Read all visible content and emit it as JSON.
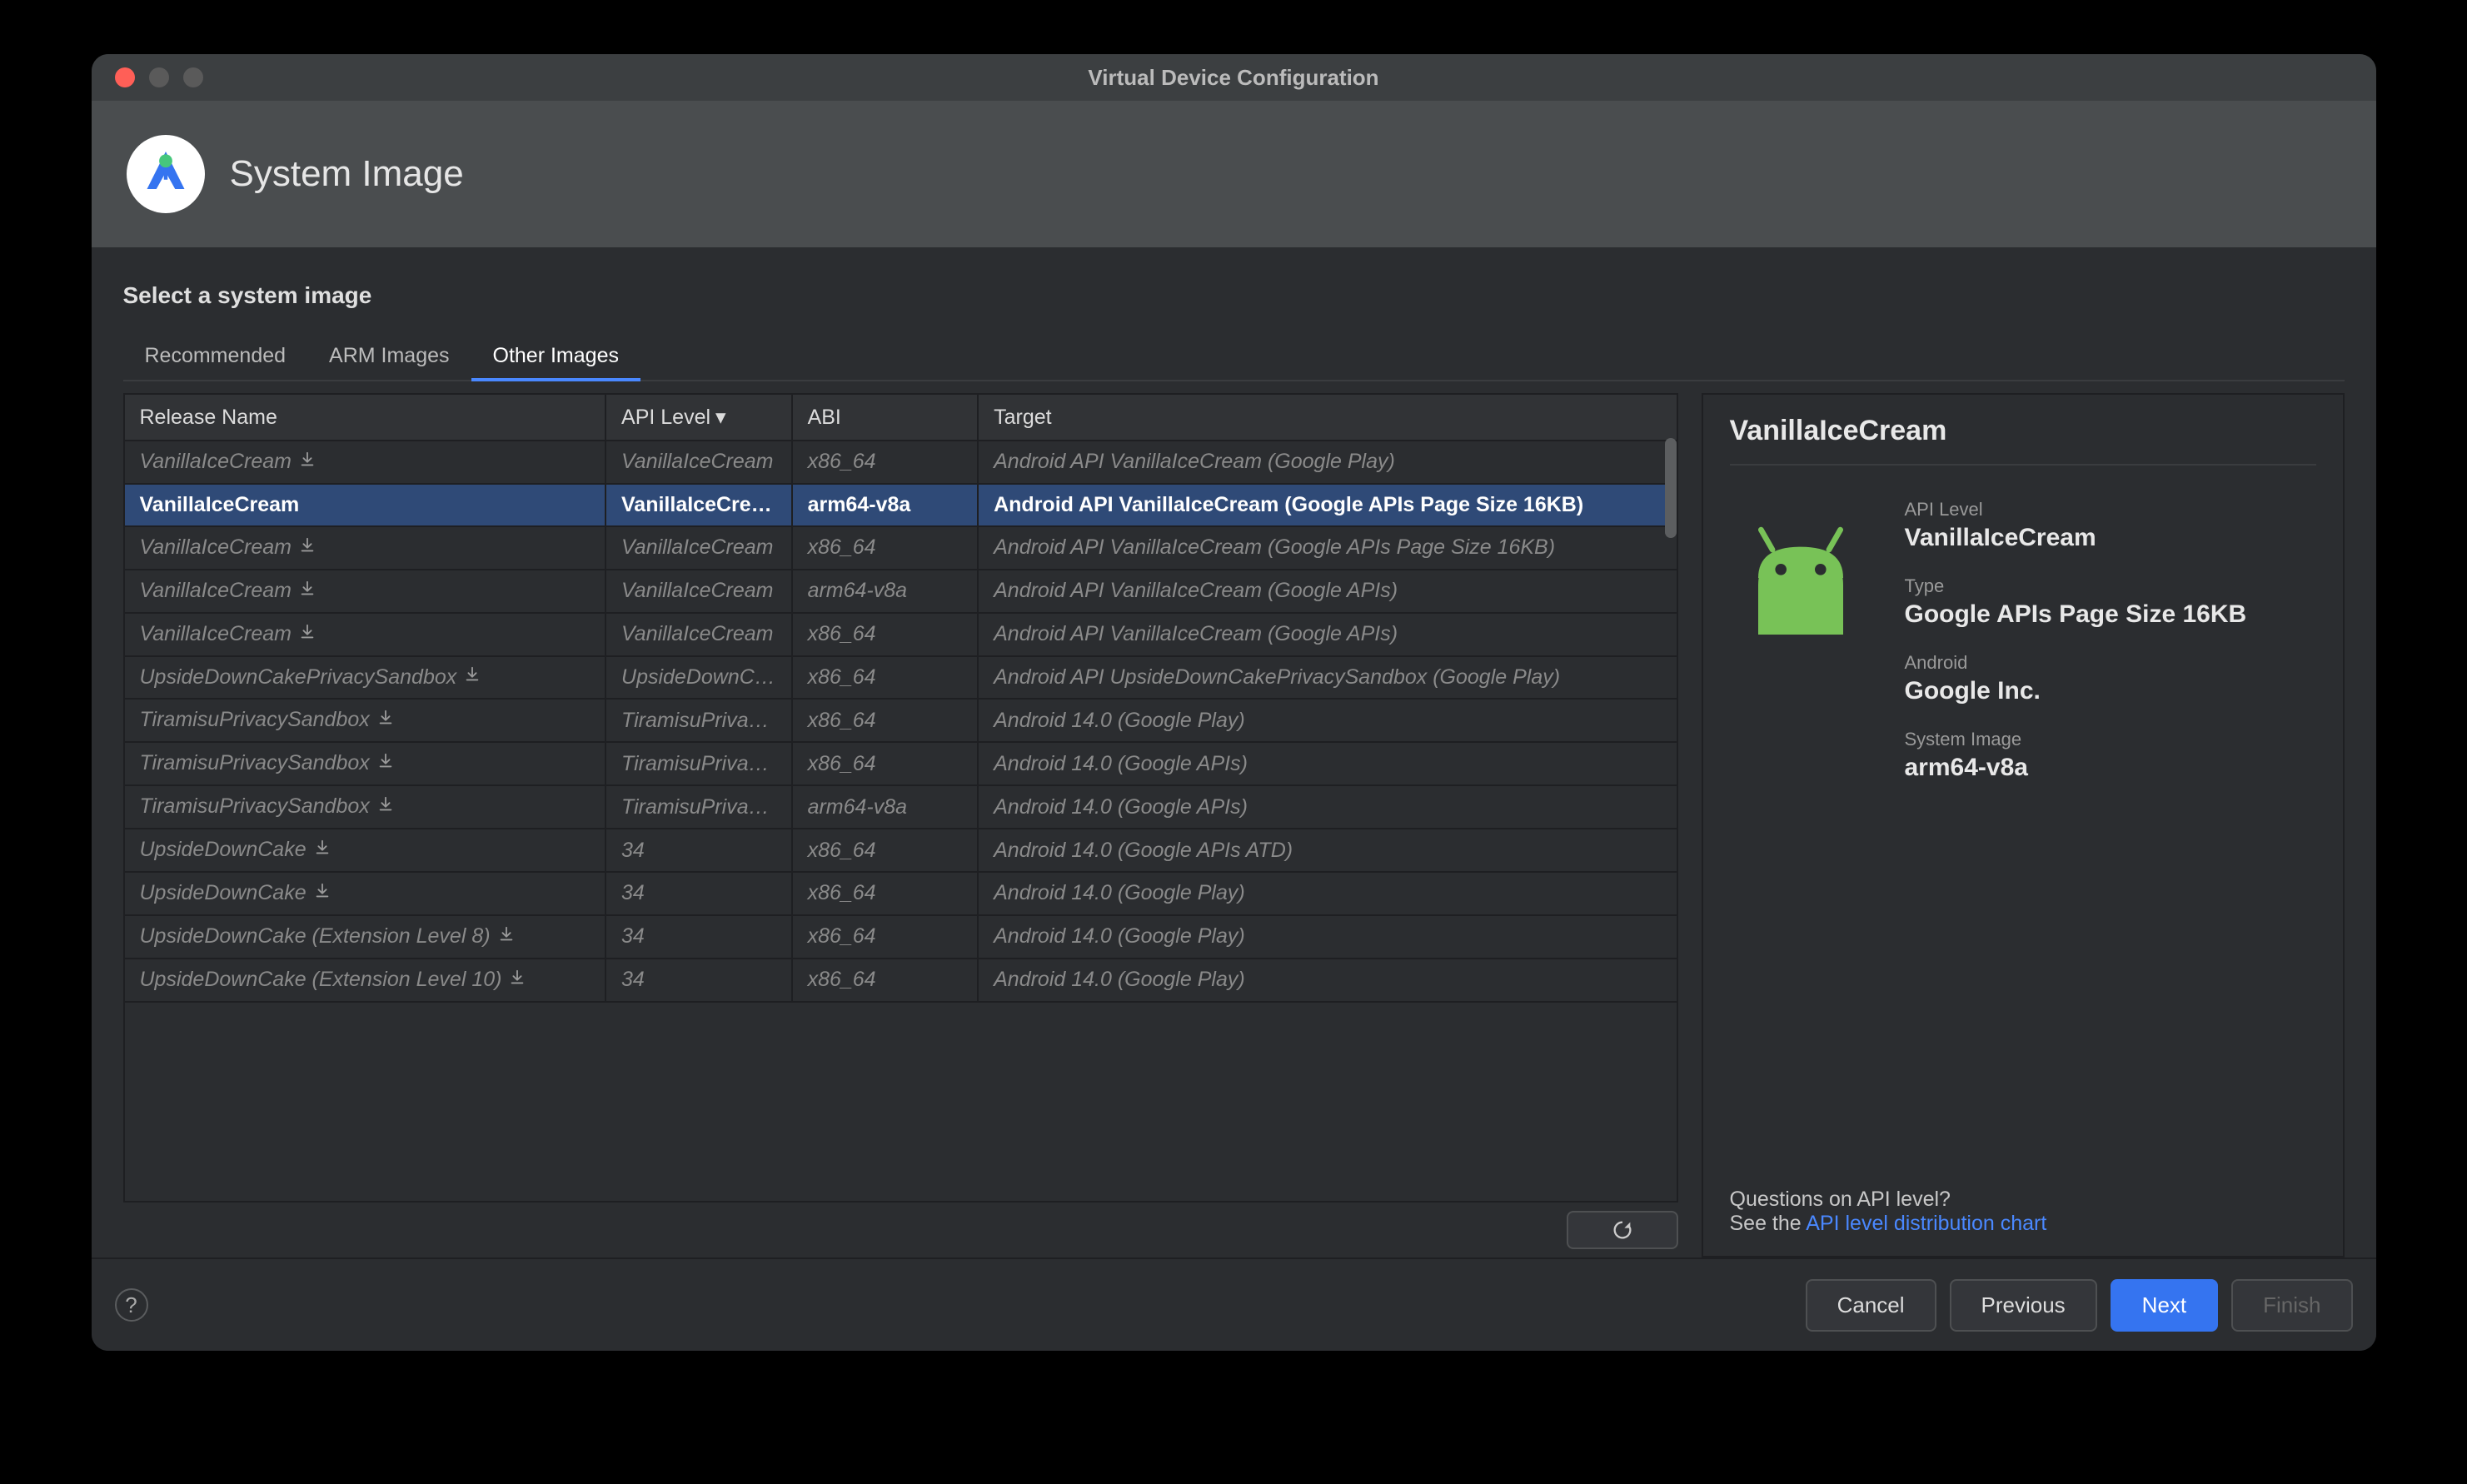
{
  "window": {
    "title": "Virtual Device Configuration"
  },
  "header": {
    "title": "System Image"
  },
  "subtitle": "Select a system image",
  "tabs": [
    {
      "label": "Recommended",
      "active": false
    },
    {
      "label": "ARM Images",
      "active": false
    },
    {
      "label": "Other Images",
      "active": true
    }
  ],
  "table": {
    "columns": {
      "release": "Release Name",
      "api": "API Level",
      "abi": "ABI",
      "target": "Target"
    },
    "rows": [
      {
        "release": "VanillaIceCream",
        "api": "VanillaIceCream",
        "abi": "x86_64",
        "target": "Android API VanillaIceCream (Google Play)",
        "download": true,
        "selected": false
      },
      {
        "release": "VanillaIceCream",
        "api": "VanillaIceCream",
        "abi": "arm64-v8a",
        "target": "Android API VanillaIceCream (Google APIs Page Size 16KB)",
        "download": false,
        "selected": true
      },
      {
        "release": "VanillaIceCream",
        "api": "VanillaIceCream",
        "abi": "x86_64",
        "target": "Android API VanillaIceCream (Google APIs Page Size 16KB)",
        "download": true,
        "selected": false
      },
      {
        "release": "VanillaIceCream",
        "api": "VanillaIceCream",
        "abi": "arm64-v8a",
        "target": "Android API VanillaIceCream (Google APIs)",
        "download": true,
        "selected": false
      },
      {
        "release": "VanillaIceCream",
        "api": "VanillaIceCream",
        "abi": "x86_64",
        "target": "Android API VanillaIceCream (Google APIs)",
        "download": true,
        "selected": false
      },
      {
        "release": "UpsideDownCakePrivacySandbox",
        "api": "UpsideDownCak",
        "abi": "x86_64",
        "target": "Android API UpsideDownCakePrivacySandbox (Google Play)",
        "download": true,
        "selected": false
      },
      {
        "release": "TiramisuPrivacySandbox",
        "api": "TiramisuPrivacyS",
        "abi": "x86_64",
        "target": "Android 14.0 (Google Play)",
        "download": true,
        "selected": false
      },
      {
        "release": "TiramisuPrivacySandbox",
        "api": "TiramisuPrivacyS",
        "abi": "x86_64",
        "target": "Android 14.0 (Google APIs)",
        "download": true,
        "selected": false
      },
      {
        "release": "TiramisuPrivacySandbox",
        "api": "TiramisuPrivacyS",
        "abi": "arm64-v8a",
        "target": "Android 14.0 (Google APIs)",
        "download": true,
        "selected": false
      },
      {
        "release": "UpsideDownCake",
        "api": "34",
        "abi": "x86_64",
        "target": "Android 14.0 (Google APIs ATD)",
        "download": true,
        "selected": false
      },
      {
        "release": "UpsideDownCake",
        "api": "34",
        "abi": "x86_64",
        "target": "Android 14.0 (Google Play)",
        "download": true,
        "selected": false
      },
      {
        "release": "UpsideDownCake (Extension Level 8)",
        "api": "34",
        "abi": "x86_64",
        "target": "Android 14.0 (Google Play)",
        "download": true,
        "selected": false
      },
      {
        "release": "UpsideDownCake (Extension Level 10)",
        "api": "34",
        "abi": "x86_64",
        "target": "Android 14.0 (Google Play)",
        "download": true,
        "selected": false
      }
    ]
  },
  "detail": {
    "title": "VanillaIceCream",
    "fields": {
      "api_level_label": "API Level",
      "api_level_value": "VanillaIceCream",
      "type_label": "Type",
      "type_value": "Google APIs Page Size 16KB",
      "android_label": "Android",
      "android_value": "Google Inc.",
      "system_image_label": "System Image",
      "system_image_value": "arm64-v8a"
    },
    "questions_prefix": "Questions on API level?",
    "see_the": "See the ",
    "link_text": "API level distribution chart"
  },
  "footer": {
    "help": "?",
    "cancel": "Cancel",
    "previous": "Previous",
    "next": "Next",
    "finish": "Finish"
  }
}
